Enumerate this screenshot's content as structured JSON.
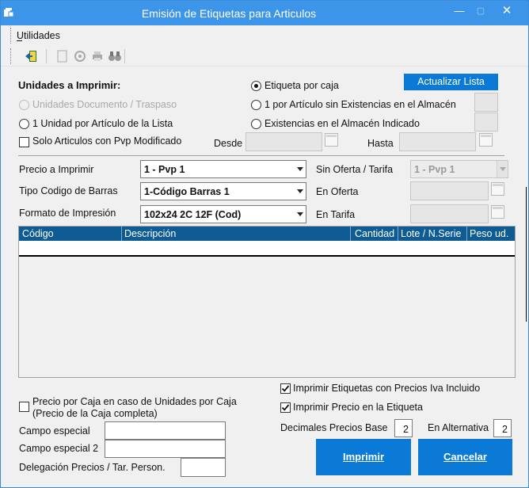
{
  "window": {
    "title": "Emisión de Etiquetas para Articulos",
    "accent": "#3c95e8"
  },
  "menu": {
    "utilidades": "Utilidades"
  },
  "toolbar": {
    "icons": [
      "exit-icon",
      "page-icon",
      "gear-icon",
      "print-icon",
      "binoculars-icon"
    ]
  },
  "units": {
    "heading": "Unidades a Imprimir:",
    "doc_traspaso": "Unidades Documento / Traspaso",
    "one_per_article": "1 Unidad por Artículo de la Lista",
    "only_pvp": "Solo Articulos con Pvp Modificado",
    "desde": "Desde",
    "hasta": "Hasta"
  },
  "options": {
    "por_caja": "Etiqueta por caja",
    "sin_existencias": "1 por Artículo sin Existencias en el Almacén",
    "existencias": "Existencias en el Almacén Indicado",
    "selected": "por_caja"
  },
  "buttons": {
    "actualizar": "Actualizar Lista",
    "imprimir": "Imprimir",
    "cancelar": "Cancelar"
  },
  "fields": {
    "precio_label": "Precio a Imprimir",
    "precio_value": "1 - Pvp 1",
    "tipo_label": "Tipo Codigo de Barras",
    "tipo_value": "1-Código Barras 1",
    "formato_label": "Formato de Impresión",
    "formato_value": "102x24 2C 12F (Cod)",
    "sin_oferta_label": "Sin Oferta / Tarifa",
    "sin_oferta_value": "1 - Pvp 1",
    "en_oferta_label": "En Oferta",
    "en_tarifa_label": "En Tarifa"
  },
  "grid": {
    "columns": [
      "Código",
      "Descripción",
      "Cantidad",
      "Lote / N.Serie",
      "Peso ud."
    ],
    "header_color": "#0f5c94"
  },
  "bottom": {
    "precio_caja_line1": "Precio por Caja en caso de Unidades por Caja",
    "precio_caja_line2": "(Precio de la Caja completa)",
    "iva_incluido": "Imprimir Etiquetas con Precios Iva Incluido",
    "imprimir_precio": "Imprimir Precio en la Etiqueta",
    "campo_especial": "Campo especial",
    "campo_especial2": "Campo especial 2",
    "delegacion": "Delegación Precios / Tar. Person.",
    "decimales_base_label": "Decimales Precios Base",
    "decimales_base_value": "2",
    "alternativa_label": "En Alternativa",
    "alternativa_value": "2"
  }
}
